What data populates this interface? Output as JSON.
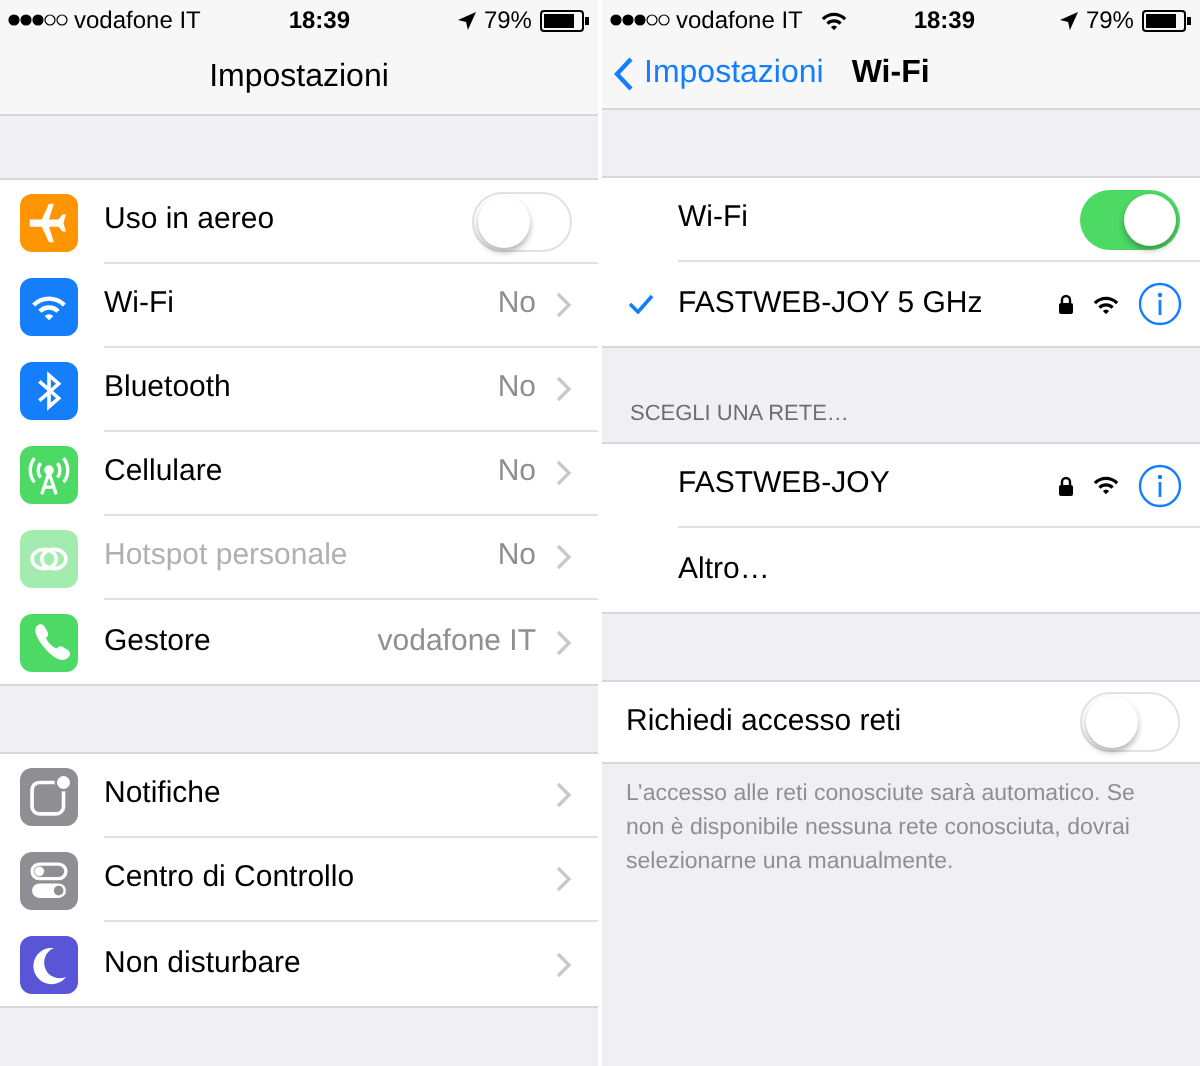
{
  "settings_screen": {
    "status_bar": {
      "carrier": "vodafone IT",
      "time": "18:39",
      "battery": "79%"
    },
    "title": "Impostazioni",
    "groups": [
      [
        {
          "kind": "toggle",
          "label": "Uso in aereo",
          "on": false,
          "disabled": false
        },
        {
          "kind": "link",
          "label": "Wi-Fi",
          "value": "No",
          "disabled": false
        },
        {
          "kind": "link",
          "label": "Bluetooth",
          "value": "No",
          "disabled": false
        },
        {
          "kind": "link",
          "label": "Cellulare",
          "value": "No",
          "disabled": false
        },
        {
          "kind": "link",
          "label": "Hotspot personale",
          "value": "No",
          "disabled": true
        },
        {
          "kind": "link",
          "label": "Gestore",
          "value": "vodafone IT",
          "disabled": false
        }
      ],
      [
        {
          "kind": "link",
          "label": "Notifiche",
          "disabled": false
        },
        {
          "kind": "link",
          "label": "Centro di Controllo",
          "disabled": false
        },
        {
          "kind": "link",
          "label": "Non disturbare",
          "disabled": false
        }
      ]
    ]
  },
  "wifi_screen": {
    "status_bar": {
      "carrier": "vodafone IT",
      "time": "18:39",
      "battery": "79%"
    },
    "back": "Impostazioni",
    "title": "Wi-Fi",
    "wifi_toggle": {
      "label": "Wi-Fi",
      "on": true
    },
    "connected": [
      {
        "name": "FASTWEB-JOY 5 GHz",
        "selected": true
      }
    ],
    "section_header": "SCEGLI UNA RETE…",
    "networks": [
      {
        "name": "FASTWEB-JOY",
        "selected": false
      }
    ],
    "other": "Altro…",
    "ask_toggle": {
      "label": "Richiedi accesso reti",
      "on": false
    },
    "footer": "L’accesso alle reti conosciute sarà automatico. Se non è disponibile nessuna rete conosciuta, dovrai selezionarne una manualmente."
  }
}
